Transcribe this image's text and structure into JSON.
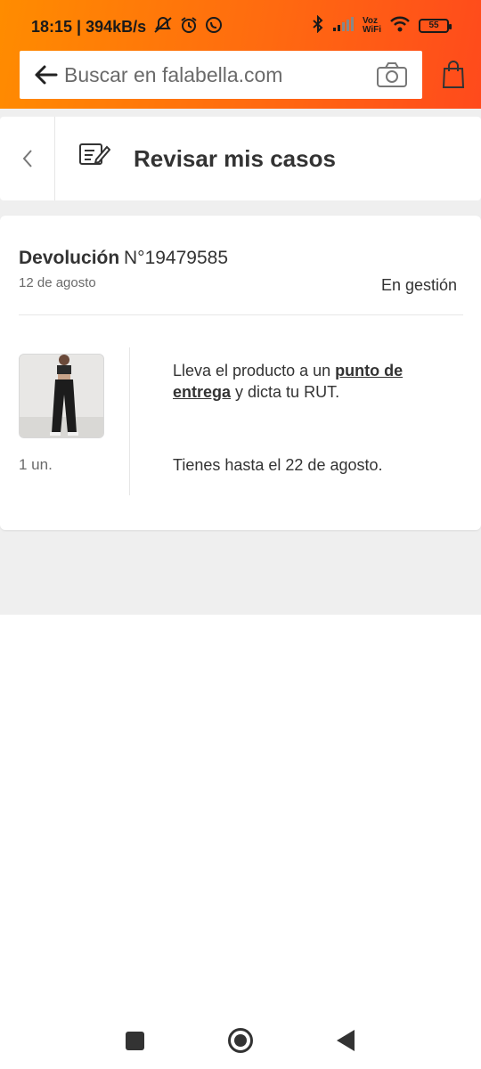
{
  "status_bar": {
    "time_speed": "18:15 | 394kB/s",
    "voz_top": "Voz",
    "voz_bottom": "WiFi",
    "battery": "55"
  },
  "search": {
    "placeholder": "Buscar en falabella.com"
  },
  "header": {
    "title": "Revisar mis casos"
  },
  "case": {
    "type": "Devolución",
    "number": "N°19479585",
    "date": "12 de agosto",
    "status": "En gestión",
    "quantity": "1 un.",
    "instruction_pre": "Lleva el producto a un ",
    "instruction_link": "punto de entrega",
    "instruction_post": " y dicta tu RUT.",
    "deadline": "Tienes hasta el 22 de agosto."
  },
  "colors": {
    "brand_orange": "#ff7a00",
    "brand_red_orange": "#ff4a1c"
  },
  "icons": {
    "back": "arrow-left-icon",
    "camera": "camera-icon",
    "bag": "shopping-bag-icon",
    "cases": "edit-document-icon",
    "collapse": "chevron-up-icon"
  }
}
